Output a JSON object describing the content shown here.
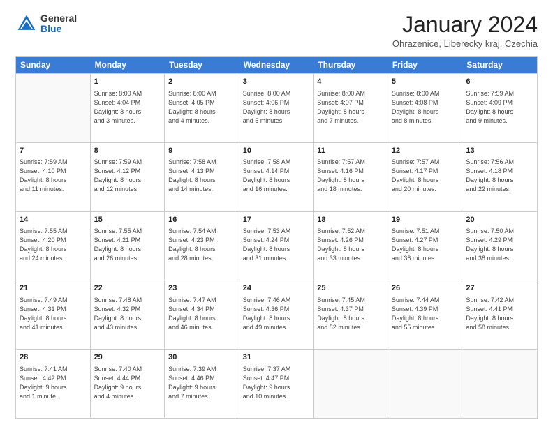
{
  "logo": {
    "general": "General",
    "blue": "Blue"
  },
  "header": {
    "title": "January 2024",
    "subtitle": "Ohrazenice, Liberecky kraj, Czechia"
  },
  "days_of_week": [
    "Sunday",
    "Monday",
    "Tuesday",
    "Wednesday",
    "Thursday",
    "Friday",
    "Saturday"
  ],
  "weeks": [
    [
      {
        "day": "",
        "lines": []
      },
      {
        "day": "1",
        "lines": [
          "Sunrise: 8:00 AM",
          "Sunset: 4:04 PM",
          "Daylight: 8 hours",
          "and 3 minutes."
        ]
      },
      {
        "day": "2",
        "lines": [
          "Sunrise: 8:00 AM",
          "Sunset: 4:05 PM",
          "Daylight: 8 hours",
          "and 4 minutes."
        ]
      },
      {
        "day": "3",
        "lines": [
          "Sunrise: 8:00 AM",
          "Sunset: 4:06 PM",
          "Daylight: 8 hours",
          "and 5 minutes."
        ]
      },
      {
        "day": "4",
        "lines": [
          "Sunrise: 8:00 AM",
          "Sunset: 4:07 PM",
          "Daylight: 8 hours",
          "and 7 minutes."
        ]
      },
      {
        "day": "5",
        "lines": [
          "Sunrise: 8:00 AM",
          "Sunset: 4:08 PM",
          "Daylight: 8 hours",
          "and 8 minutes."
        ]
      },
      {
        "day": "6",
        "lines": [
          "Sunrise: 7:59 AM",
          "Sunset: 4:09 PM",
          "Daylight: 8 hours",
          "and 9 minutes."
        ]
      }
    ],
    [
      {
        "day": "7",
        "lines": [
          "Sunrise: 7:59 AM",
          "Sunset: 4:10 PM",
          "Daylight: 8 hours",
          "and 11 minutes."
        ]
      },
      {
        "day": "8",
        "lines": [
          "Sunrise: 7:59 AM",
          "Sunset: 4:12 PM",
          "Daylight: 8 hours",
          "and 12 minutes."
        ]
      },
      {
        "day": "9",
        "lines": [
          "Sunrise: 7:58 AM",
          "Sunset: 4:13 PM",
          "Daylight: 8 hours",
          "and 14 minutes."
        ]
      },
      {
        "day": "10",
        "lines": [
          "Sunrise: 7:58 AM",
          "Sunset: 4:14 PM",
          "Daylight: 8 hours",
          "and 16 minutes."
        ]
      },
      {
        "day": "11",
        "lines": [
          "Sunrise: 7:57 AM",
          "Sunset: 4:16 PM",
          "Daylight: 8 hours",
          "and 18 minutes."
        ]
      },
      {
        "day": "12",
        "lines": [
          "Sunrise: 7:57 AM",
          "Sunset: 4:17 PM",
          "Daylight: 8 hours",
          "and 20 minutes."
        ]
      },
      {
        "day": "13",
        "lines": [
          "Sunrise: 7:56 AM",
          "Sunset: 4:18 PM",
          "Daylight: 8 hours",
          "and 22 minutes."
        ]
      }
    ],
    [
      {
        "day": "14",
        "lines": [
          "Sunrise: 7:55 AM",
          "Sunset: 4:20 PM",
          "Daylight: 8 hours",
          "and 24 minutes."
        ]
      },
      {
        "day": "15",
        "lines": [
          "Sunrise: 7:55 AM",
          "Sunset: 4:21 PM",
          "Daylight: 8 hours",
          "and 26 minutes."
        ]
      },
      {
        "day": "16",
        "lines": [
          "Sunrise: 7:54 AM",
          "Sunset: 4:23 PM",
          "Daylight: 8 hours",
          "and 28 minutes."
        ]
      },
      {
        "day": "17",
        "lines": [
          "Sunrise: 7:53 AM",
          "Sunset: 4:24 PM",
          "Daylight: 8 hours",
          "and 31 minutes."
        ]
      },
      {
        "day": "18",
        "lines": [
          "Sunrise: 7:52 AM",
          "Sunset: 4:26 PM",
          "Daylight: 8 hours",
          "and 33 minutes."
        ]
      },
      {
        "day": "19",
        "lines": [
          "Sunrise: 7:51 AM",
          "Sunset: 4:27 PM",
          "Daylight: 8 hours",
          "and 36 minutes."
        ]
      },
      {
        "day": "20",
        "lines": [
          "Sunrise: 7:50 AM",
          "Sunset: 4:29 PM",
          "Daylight: 8 hours",
          "and 38 minutes."
        ]
      }
    ],
    [
      {
        "day": "21",
        "lines": [
          "Sunrise: 7:49 AM",
          "Sunset: 4:31 PM",
          "Daylight: 8 hours",
          "and 41 minutes."
        ]
      },
      {
        "day": "22",
        "lines": [
          "Sunrise: 7:48 AM",
          "Sunset: 4:32 PM",
          "Daylight: 8 hours",
          "and 43 minutes."
        ]
      },
      {
        "day": "23",
        "lines": [
          "Sunrise: 7:47 AM",
          "Sunset: 4:34 PM",
          "Daylight: 8 hours",
          "and 46 minutes."
        ]
      },
      {
        "day": "24",
        "lines": [
          "Sunrise: 7:46 AM",
          "Sunset: 4:36 PM",
          "Daylight: 8 hours",
          "and 49 minutes."
        ]
      },
      {
        "day": "25",
        "lines": [
          "Sunrise: 7:45 AM",
          "Sunset: 4:37 PM",
          "Daylight: 8 hours",
          "and 52 minutes."
        ]
      },
      {
        "day": "26",
        "lines": [
          "Sunrise: 7:44 AM",
          "Sunset: 4:39 PM",
          "Daylight: 8 hours",
          "and 55 minutes."
        ]
      },
      {
        "day": "27",
        "lines": [
          "Sunrise: 7:42 AM",
          "Sunset: 4:41 PM",
          "Daylight: 8 hours",
          "and 58 minutes."
        ]
      }
    ],
    [
      {
        "day": "28",
        "lines": [
          "Sunrise: 7:41 AM",
          "Sunset: 4:42 PM",
          "Daylight: 9 hours",
          "and 1 minute."
        ]
      },
      {
        "day": "29",
        "lines": [
          "Sunrise: 7:40 AM",
          "Sunset: 4:44 PM",
          "Daylight: 9 hours",
          "and 4 minutes."
        ]
      },
      {
        "day": "30",
        "lines": [
          "Sunrise: 7:39 AM",
          "Sunset: 4:46 PM",
          "Daylight: 9 hours",
          "and 7 minutes."
        ]
      },
      {
        "day": "31",
        "lines": [
          "Sunrise: 7:37 AM",
          "Sunset: 4:47 PM",
          "Daylight: 9 hours",
          "and 10 minutes."
        ]
      },
      {
        "day": "",
        "lines": []
      },
      {
        "day": "",
        "lines": []
      },
      {
        "day": "",
        "lines": []
      }
    ]
  ]
}
